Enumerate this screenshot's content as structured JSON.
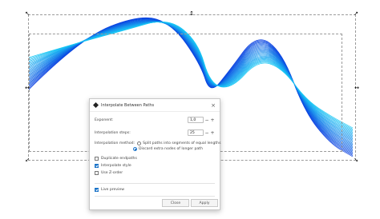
{
  "colors": {
    "wave_dark": "#0a3fe0",
    "wave_light": "#19c8f5",
    "accent": "#1a73c8"
  },
  "dialog": {
    "title": "Interpolate Between Paths",
    "close_icon": "close-icon",
    "exponent": {
      "label": "Exponent:",
      "value": "1,0"
    },
    "steps": {
      "label": "Interpolation steps:",
      "value": "25"
    },
    "method": {
      "label": "Interpolation method:",
      "options": [
        {
          "label": "Split paths into segments of equal lengths",
          "selected": false
        },
        {
          "label": "Discard extra nodes of longer path",
          "selected": true
        }
      ]
    },
    "checkboxes": [
      {
        "label": "Duplicate endpaths",
        "checked": false
      },
      {
        "label": "Interpolate style",
        "checked": true
      },
      {
        "label": "Use Z-order",
        "checked": false
      }
    ],
    "live_preview": {
      "label": "Live preview",
      "checked": true
    },
    "buttons": {
      "close": "Close",
      "apply": "Apply"
    }
  }
}
